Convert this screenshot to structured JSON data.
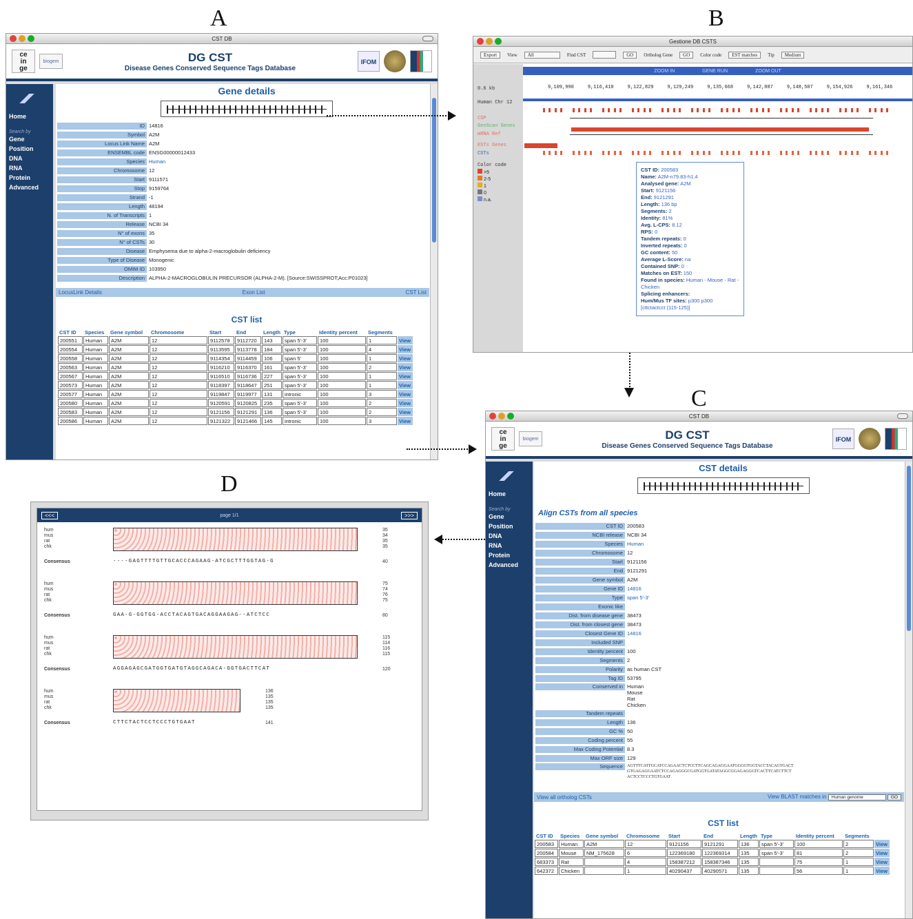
{
  "panel_labels": {
    "a": "A",
    "b": "B",
    "c": "C",
    "d": "D"
  },
  "windowA": {
    "title": "CST DB",
    "header": {
      "logo1": "ce\nin\nge",
      "logo2": "biogem",
      "title": "DG CST",
      "subtitle": "Disease Genes Conserved Sequence Tags Database",
      "logo3": "IFOM"
    },
    "sidebar": {
      "home": "Home",
      "search_by": "Search by",
      "items": [
        "Gene",
        "Position",
        "DNA",
        "RNA",
        "Protein",
        "Advanced"
      ]
    },
    "section": "Gene details",
    "fields": [
      [
        "ID",
        "14816",
        false
      ],
      [
        "Symbol",
        "A2M",
        false
      ],
      [
        "Locus Link Name",
        "A2M",
        false
      ],
      [
        "ENSEMBL code",
        "ENSG00000012433",
        false
      ],
      [
        "Species",
        "Human",
        true
      ],
      [
        "Chromosome",
        "12",
        false
      ],
      [
        "Start",
        "9111571",
        false
      ],
      [
        "Stop",
        "9159764",
        false
      ],
      [
        "Strand",
        "-1",
        false
      ],
      [
        "Length",
        "48194",
        false
      ],
      [
        "N. of Transcripts",
        "1",
        false
      ],
      [
        "Release",
        "NCBI 34",
        false
      ],
      [
        "N° of exons",
        "35",
        false
      ],
      [
        "N° of CSTs",
        "30",
        false
      ],
      [
        "Disease",
        "Emphysema due to alpha-2-macroglobulin deficiency",
        false
      ],
      [
        "Type of Disease",
        "Monogenic",
        false
      ],
      [
        "OMIM ID",
        "103950",
        false
      ],
      [
        "Description",
        "ALPHA-2-MACROGLOBULIN PRECURSOR (ALPHA-2-M). [Source:SWISSPROT;Acc:P01023]",
        false
      ]
    ],
    "links": [
      "LocusLink Details",
      "Exon List",
      "CST List"
    ],
    "cst_title": "CST list",
    "cst_headers": [
      "CST ID",
      "Species",
      "Gene symbol",
      "Chromosome",
      "Start",
      "End",
      "Length",
      "Type",
      "Identity percent",
      "Segments",
      ""
    ],
    "cst_rows": [
      [
        "200551",
        "Human",
        "A2M",
        "12",
        "9112578",
        "9112720",
        "143",
        "span 5'-3'",
        "100",
        "1",
        "View"
      ],
      [
        "200554",
        "Human",
        "A2M",
        "12",
        "9113595",
        "9113778",
        "184",
        "span 5'-3'",
        "100",
        "4",
        "View"
      ],
      [
        "200558",
        "Human",
        "A2M",
        "12",
        "9114354",
        "9114459",
        "106",
        "span 5'",
        "100",
        "1",
        "View"
      ],
      [
        "200563",
        "Human",
        "A2M",
        "12",
        "9116210",
        "9116370",
        "161",
        "span 5'-3'",
        "100",
        "2",
        "View"
      ],
      [
        "200567",
        "Human",
        "A2M",
        "12",
        "9116510",
        "9116736",
        "227",
        "span 5'-3'",
        "100",
        "1",
        "View"
      ],
      [
        "200573",
        "Human",
        "A2M",
        "12",
        "9118397",
        "9118647",
        "251",
        "span 5'-3'",
        "100",
        "1",
        "View"
      ],
      [
        "200577",
        "Human",
        "A2M",
        "12",
        "9119847",
        "9119977",
        "131",
        "intronic",
        "100",
        "3",
        "View"
      ],
      [
        "200580",
        "Human",
        "A2M",
        "12",
        "9120591",
        "9120825",
        "235",
        "span 5'-3'",
        "100",
        "2",
        "View"
      ],
      [
        "200583",
        "Human",
        "A2M",
        "12",
        "9121156",
        "9121291",
        "136",
        "span 5'-3'",
        "100",
        "2",
        "View"
      ],
      [
        "200586",
        "Human",
        "A2M",
        "12",
        "9121322",
        "9121466",
        "145",
        "intronic",
        "100",
        "3",
        "View"
      ]
    ]
  },
  "windowB": {
    "title": "Gestione DB CSTS",
    "toolbar": {
      "export": "Export",
      "view": "View",
      "view_val": "All",
      "find": "Find CST",
      "go": "GO",
      "ortholog": "Ortholog Gene",
      "go2": "GO",
      "colorcode": "Color code",
      "colorcode_val": "EST matches",
      "tip": "Tip",
      "tip_val": "Medium"
    },
    "zoom": [
      "ZOOM IN",
      "GENE RUN",
      "ZOOM OUT"
    ],
    "scale": "0.6 kb",
    "ticks": [
      "9,109,990",
      "9,116,410",
      "9,122,829",
      "9,129,249",
      "9,135,668",
      "9,142,087",
      "9,148,507",
      "9,154,926",
      "9,161,346"
    ],
    "tracks": [
      "Human Chr 12",
      "CSP",
      "GenScan Genes",
      "mRNA Ref",
      "ESTs Genes",
      "CSTs",
      "Color code"
    ],
    "legend": [
      [
        ">5",
        "#d9452e"
      ],
      [
        "2-5",
        "#e27a2d"
      ],
      [
        "1",
        "#e0b020"
      ],
      [
        "0",
        "#777"
      ],
      [
        "n.a.",
        "#7a8fc7"
      ]
    ],
    "popup": [
      [
        "CST ID:",
        "200583"
      ],
      [
        "Name:",
        "A2M-n79.83-h1.4"
      ],
      [
        "Analysed gene:",
        "A2M"
      ],
      [
        "Start:",
        "9121156"
      ],
      [
        "End:",
        "9121291"
      ],
      [
        "Length:",
        "136 bp"
      ],
      [
        "Segments:",
        "2"
      ],
      [
        "Identity:",
        "81%"
      ],
      [
        "Avg. L-CPS:",
        "8.12"
      ],
      [
        "RPS:",
        "0"
      ],
      [
        "Tandem repeats:",
        "0"
      ],
      [
        "Inverted repeats:",
        "0"
      ],
      [
        "GC content:",
        "50"
      ],
      [
        "Average L-Score:",
        "na"
      ],
      [
        "Contained SNP:",
        "0"
      ],
      [
        "Matches on EST:",
        "150"
      ],
      [
        "Found in species:",
        "Human - Mouse - Rat - Chicken"
      ],
      [
        "Splicing enhancers:",
        ""
      ],
      [
        "Hum/Mus TF sites:",
        "p300 p300"
      ],
      [
        "",
        "[cttctactcct (115-125)]"
      ]
    ]
  },
  "windowC": {
    "title": "CST DB",
    "section": "CST details",
    "align_link": "Align CSTs from all species",
    "fields": [
      [
        "CST ID",
        "200583",
        false
      ],
      [
        "NCBI release",
        "NCBI 34",
        false
      ],
      [
        "Species",
        "Human",
        true
      ],
      [
        "Chromosome",
        "12",
        false
      ],
      [
        "Start",
        "9121156",
        false
      ],
      [
        "End",
        "9121291",
        false
      ],
      [
        "Gene symbol",
        "A2M",
        false
      ],
      [
        "Gene ID",
        "14816",
        true
      ],
      [
        "Type",
        "span 5'-3'",
        true
      ],
      [
        "Exonic like",
        "",
        false
      ],
      [
        "Dist. from disease gene",
        "38473",
        false
      ],
      [
        "Dist. from closest gene",
        "38473",
        false
      ],
      [
        "Closest Gene ID",
        "14816",
        true
      ],
      [
        "Included SNP",
        "",
        false
      ],
      [
        "Identity percent",
        "100",
        false
      ],
      [
        "Segments",
        "2",
        false
      ],
      [
        "Polarity",
        "as human CST",
        false
      ],
      [
        "Tag ID",
        "53795",
        false
      ],
      [
        "Conserved in",
        "Human\nMouse\nRat\nChicken",
        false
      ],
      [
        "Tandem repeats",
        "",
        false
      ],
      [
        "Length",
        "136",
        false
      ],
      [
        "GC %",
        "50",
        false
      ],
      [
        "Coding percent",
        "55",
        false
      ],
      [
        "Max Coding Potential",
        "8.3",
        false
      ],
      [
        "Max ORF size",
        "129",
        false
      ],
      [
        "Sequence",
        "AGTTTCATTGCATCCAGAACTCTCCTTCAGCAGAGGAATGGGGTGGTACCTACAGTGACT\nGTGAGAGGAATCTCCAGAGGGCGATGGTGATATAGGCGGAGAGGGTCACTTCATCTTCT\nACTCCTCCCTGTGAAT",
        false
      ]
    ],
    "links": {
      "ortholog": "View all ortholog CSTs",
      "blast": "View BLAST matches in",
      "blast_val": "Human genome",
      "go": "GO"
    },
    "cst_title": "CST list",
    "cst_headers": [
      "CST ID",
      "Species",
      "Gene symbol",
      "Chromosome",
      "Start",
      "End",
      "Length",
      "Type",
      "Identity percent",
      "Segments",
      ""
    ],
    "cst_rows": [
      [
        "200583",
        "Human",
        "A2M",
        "12",
        "9121156",
        "9121291",
        "136",
        "span 5'-3'",
        "100",
        "2",
        "View"
      ],
      [
        "200584",
        "Mouse",
        "NM_175628",
        "6",
        "122369180",
        "122369314",
        "135",
        "span 5'-3'",
        "81",
        "2",
        "View"
      ],
      [
        "683373",
        "Rat",
        "",
        "4",
        "158387212",
        "158387346",
        "135",
        "",
        "75",
        "1",
        "View"
      ],
      [
        "642372",
        "Chicken",
        "",
        "1",
        "40290437",
        "40290571",
        "135",
        "",
        "56",
        "1",
        "View"
      ]
    ]
  },
  "windowD": {
    "prev": "<<<",
    "next": ">>>",
    "page": "page 1/1",
    "blocks": [
      {
        "names": [
          "hum",
          "mus",
          "rat",
          "chk"
        ],
        "nums": [
          "35",
          "34",
          "35",
          "35"
        ],
        "consensus": "----GAGTTTTGTTGCACCCAGAAG-ATCGCTTTGGTAG-G",
        "cnum": "40"
      },
      {
        "names": [
          "hum",
          "mus",
          "rat",
          "chk"
        ],
        "nums": [
          "75",
          "74",
          "76",
          "75"
        ],
        "consensus": "GAA-G-GGTGG-ACCTACAGTGACAGGAAGAG--ATCTCC",
        "cnum": "80"
      },
      {
        "names": [
          "hum",
          "mus",
          "rat",
          "chk"
        ],
        "nums": [
          "115",
          "114",
          "116",
          "115"
        ],
        "consensus": "AGGAGAGCGATGGTGATGTAGGCAGACA-GGTGACTTCAT",
        "cnum": "120"
      },
      {
        "names": [
          "hum",
          "mus",
          "rat",
          "chk"
        ],
        "nums": [
          "136",
          "135",
          "135",
          "135"
        ],
        "consensus": "CTTCTACTCCTCCCTGTGAAT",
        "cnum": "141"
      }
    ],
    "consensus_label": "Consensus"
  }
}
